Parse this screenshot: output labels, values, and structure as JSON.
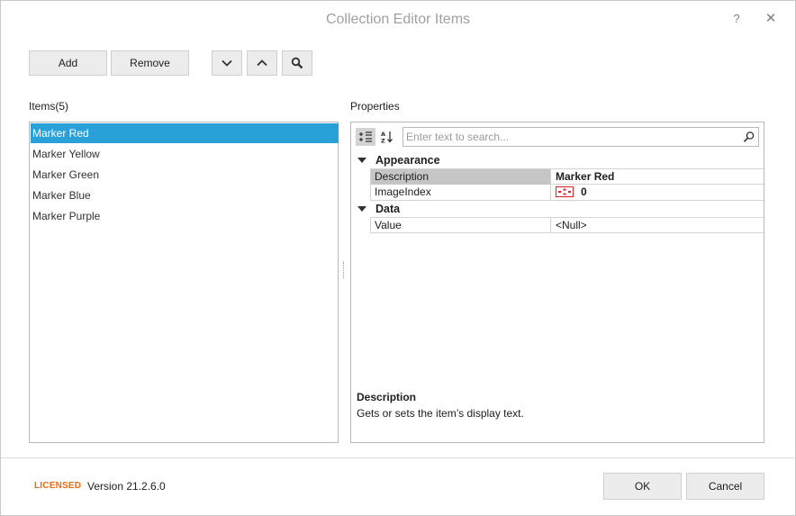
{
  "window": {
    "title": "Collection Editor Items",
    "help_label": "?",
    "close_label": "✕"
  },
  "toolbar": {
    "add_label": "Add",
    "remove_label": "Remove",
    "move_down_icon": "chevron-down",
    "move_up_icon": "chevron-up",
    "search_icon": "magnifier"
  },
  "items": {
    "header": "Items(5)",
    "list": [
      {
        "label": "Marker Red",
        "selected": true
      },
      {
        "label": "Marker Yellow",
        "selected": false
      },
      {
        "label": "Marker Green",
        "selected": false
      },
      {
        "label": "Marker Blue",
        "selected": false
      },
      {
        "label": "Marker Purple",
        "selected": false
      }
    ]
  },
  "properties": {
    "header": "Properties",
    "search_placeholder": "Enter text to search...",
    "categories": [
      {
        "name": "Appearance",
        "rows": [
          {
            "name": "Description",
            "value": "Marker Red",
            "selected": true
          },
          {
            "name": "ImageIndex",
            "value": "0",
            "selected": false
          }
        ]
      },
      {
        "name": "Data",
        "rows": [
          {
            "name": "Value",
            "value": "<Null>",
            "selected": false
          }
        ]
      }
    ],
    "description": {
      "title": "Description",
      "text": "Gets or sets the item’s display text."
    }
  },
  "footer": {
    "licensed": "LICENSED",
    "version": "Version 21.2.6.0",
    "ok_label": "OK",
    "cancel_label": "Cancel"
  },
  "colors": {
    "selection": "#2aa0d8",
    "licensed": "#ee6a0f",
    "grid_selected": "#c6c6c6",
    "marker_red": "#e02020"
  }
}
